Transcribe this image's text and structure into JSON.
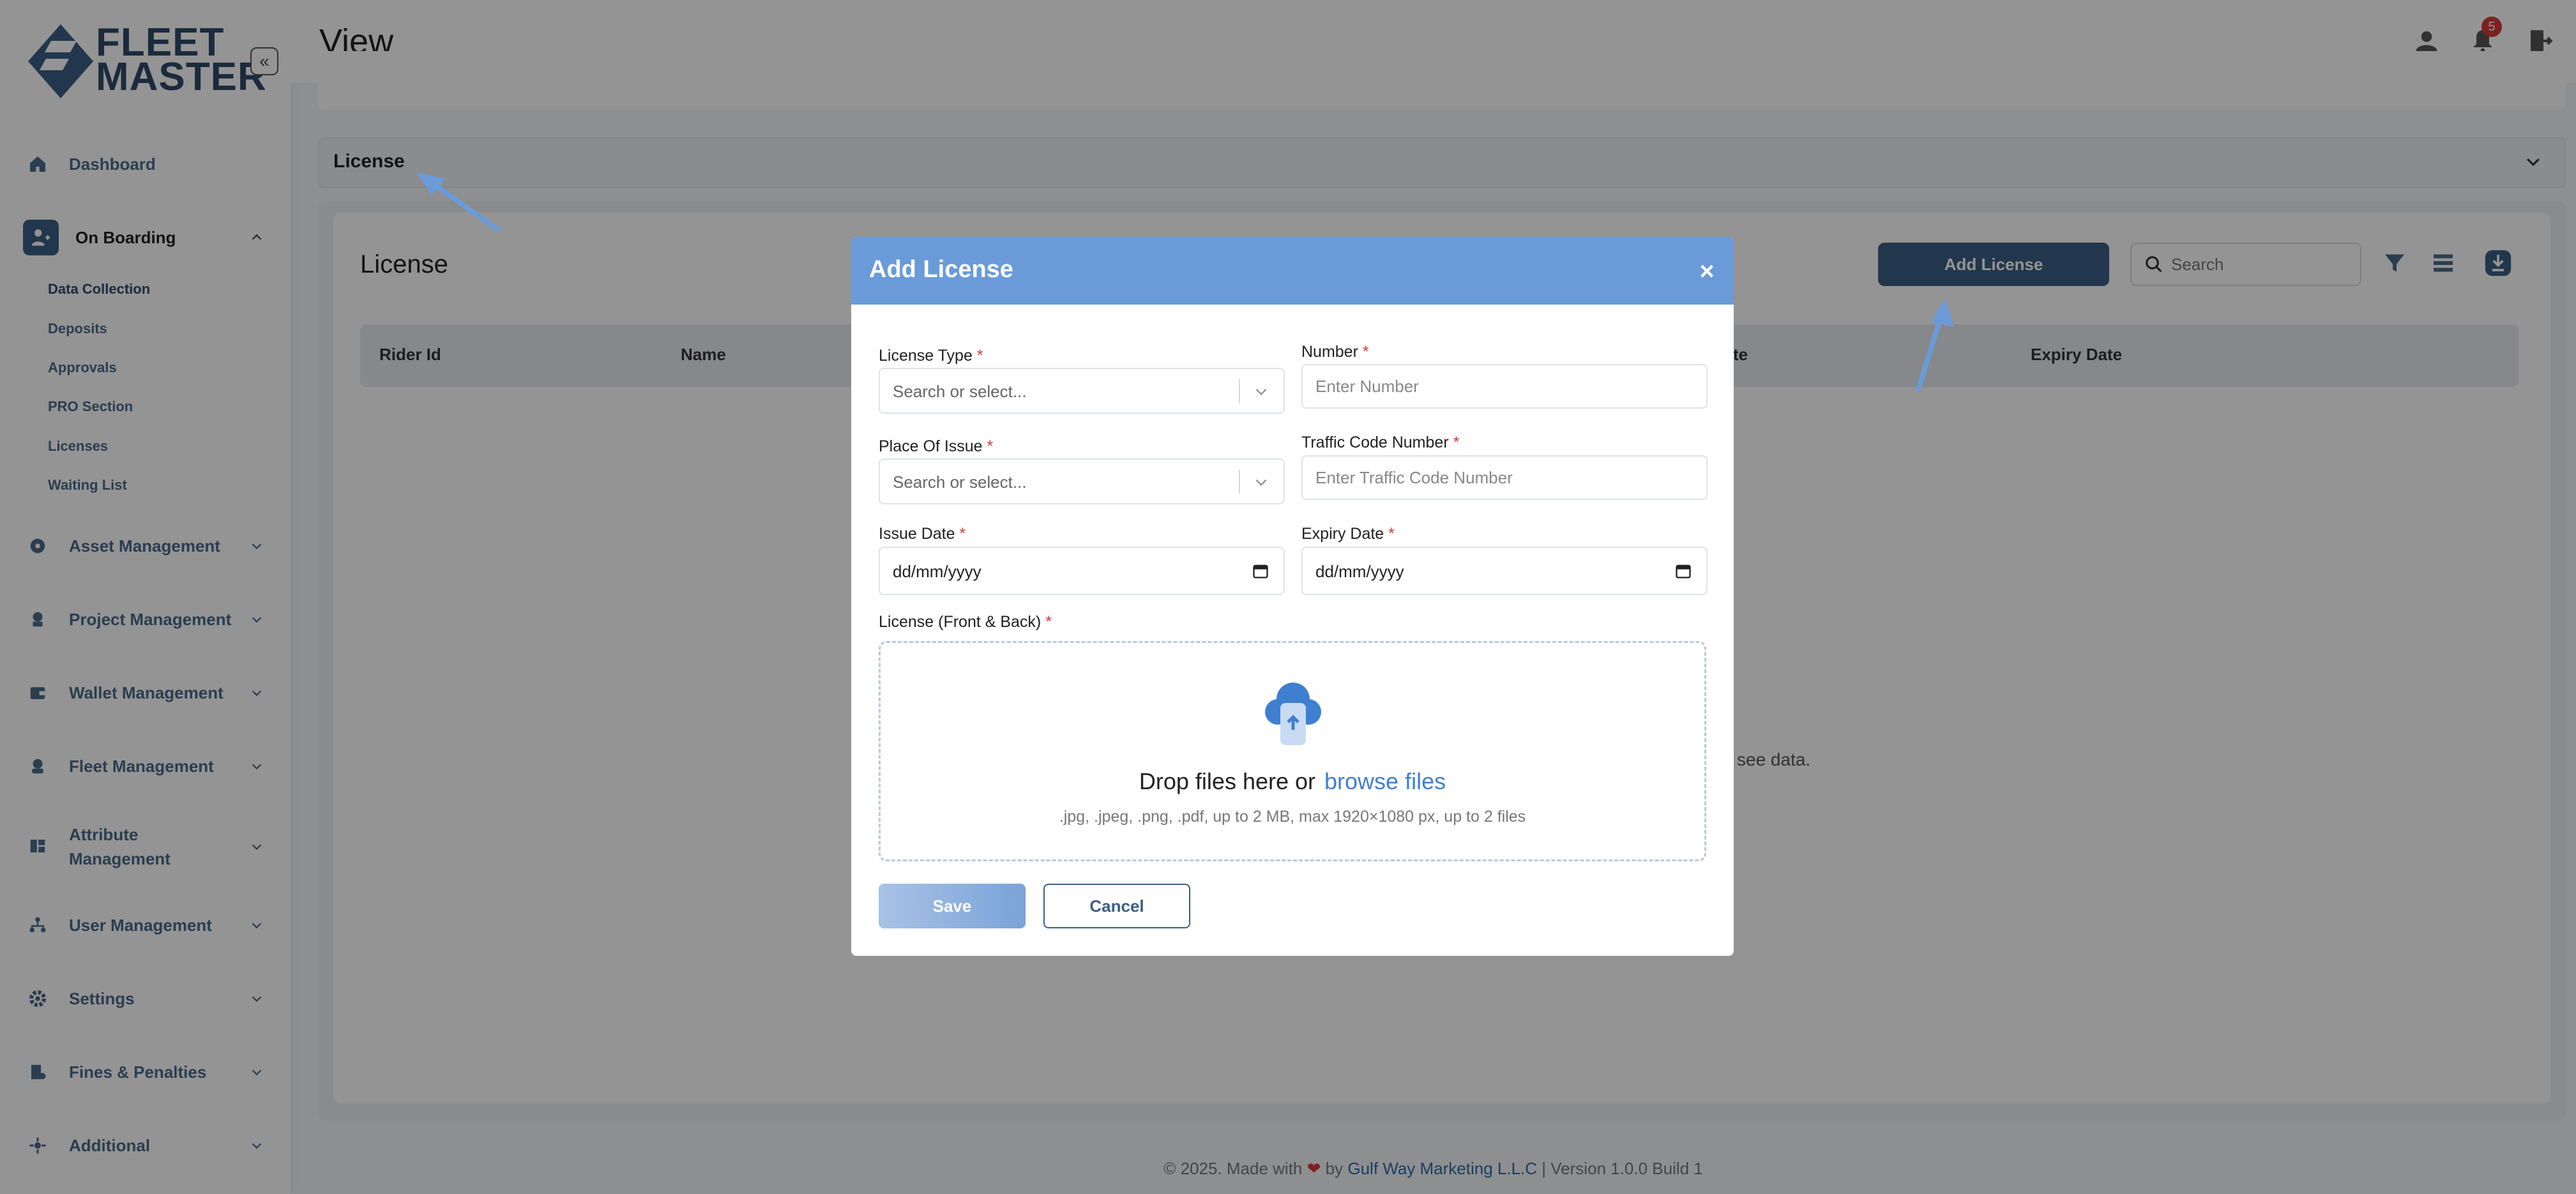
{
  "app": {
    "brand_line1": "FLEET",
    "brand_line2": "MASTER"
  },
  "header": {
    "page_title": "View",
    "notification_count": "5"
  },
  "sidebar": {
    "items": [
      {
        "label": "Dashboard",
        "icon": "home-icon"
      },
      {
        "label": "On Boarding",
        "icon": "onboarding-icon",
        "expanded": true
      },
      {
        "label": "Asset Management",
        "icon": "asset-icon"
      },
      {
        "label": "Project Management",
        "icon": "project-icon"
      },
      {
        "label": "Wallet Management",
        "icon": "wallet-icon"
      },
      {
        "label": "Fleet Management",
        "icon": "fleet-icon"
      },
      {
        "label": "Attribute Management",
        "icon": "attribute-icon"
      },
      {
        "label": "User Management",
        "icon": "users-icon"
      },
      {
        "label": "Settings",
        "icon": "gear-icon"
      },
      {
        "label": "Fines & Penalties",
        "icon": "fines-icon"
      },
      {
        "label": "Additional",
        "icon": "additional-icon"
      }
    ],
    "onboarding_sub": [
      "Data Collection",
      "Deposits",
      "Approvals",
      "PRO Section",
      "Licenses",
      "Waiting List"
    ]
  },
  "content": {
    "accordion_label": "License",
    "table_title": "License",
    "add_button": "Add License",
    "search_placeholder": "Search",
    "columns": [
      "Rider Id",
      "Name",
      "te",
      "Expiry Date"
    ],
    "empty_text_fragment": "see data."
  },
  "modal": {
    "title": "Add License",
    "close": "×",
    "fields": {
      "license_type": {
        "label": "License Type",
        "placeholder": "Search or select..."
      },
      "number": {
        "label": "Number",
        "placeholder": "Enter Number"
      },
      "place_of_issue": {
        "label": "Place Of Issue",
        "placeholder": "Search or select..."
      },
      "traffic_code": {
        "label": "Traffic Code Number",
        "placeholder": "Enter Traffic Code Number"
      },
      "issue_date": {
        "label": "Issue Date",
        "value": "dd/mm/yyyy"
      },
      "expiry_date": {
        "label": "Expiry Date",
        "value": "dd/mm/yyyy"
      },
      "license_file": {
        "label": "License (Front & Back)"
      }
    },
    "required_mark": "*",
    "dropzone": {
      "main_text": "Drop files here or",
      "browse_text": "browse files",
      "hint": ".jpg, .jpeg, .png, .pdf, up to 2 MB, max 1920×1080 px, up to 2 files"
    },
    "save": "Save",
    "cancel": "Cancel"
  },
  "footer": {
    "prefix": "© 2025. Made with",
    "by": "by",
    "company": "Gulf Way Marketing L.L.C",
    "suffix": "| Version 1.0.0 Build 1"
  },
  "colors": {
    "primary": "#3c5f86",
    "modal_header": "#6a9bd8",
    "link": "#3f7fd0",
    "badge": "#d63a3a"
  }
}
